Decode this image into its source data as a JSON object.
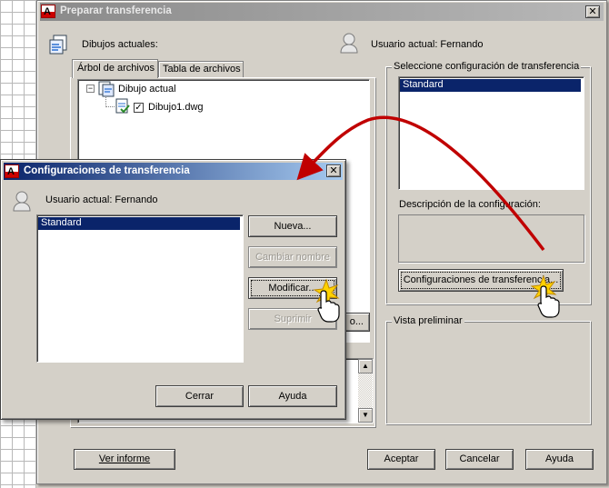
{
  "main_window": {
    "title": "Preparar transferencia",
    "drawings_label": "Dibujos actuales:",
    "current_user": "Usuario actual: Fernando",
    "tabs": [
      {
        "label": "Árbol de archivos",
        "active": true
      },
      {
        "label": "Tabla de archivos",
        "active": false
      }
    ],
    "tree": {
      "root": "Dibujo actual",
      "child": "Dibujo1.dwg",
      "child_checked": true,
      "root_expander": "−"
    },
    "config_group_title": "Seleccione configuración de transferencia",
    "config_list": [
      "Standard"
    ],
    "config_desc_label": "Descripción de la configuración:",
    "config_button": "Configuraciones de transferencia...",
    "preview_group_title": "Vista preliminar",
    "partial_button": "o...",
    "buttons": {
      "report": "Ver informe",
      "accept": "Aceptar",
      "cancel": "Cancelar",
      "help": "Ayuda"
    }
  },
  "dialog": {
    "title": "Configuraciones de transferencia",
    "current_user": "Usuario actual: Fernando",
    "list": [
      "Standard"
    ],
    "buttons": {
      "new": "Nueva...",
      "rename": "Cambiar nombre",
      "modify": "Modificar...",
      "delete": "Suprimir",
      "close": "Cerrar",
      "help": "Ayuda"
    }
  },
  "colors": {
    "title_active": "#0a246a",
    "title_inactive": "#808080",
    "arrow": "#c00000"
  }
}
